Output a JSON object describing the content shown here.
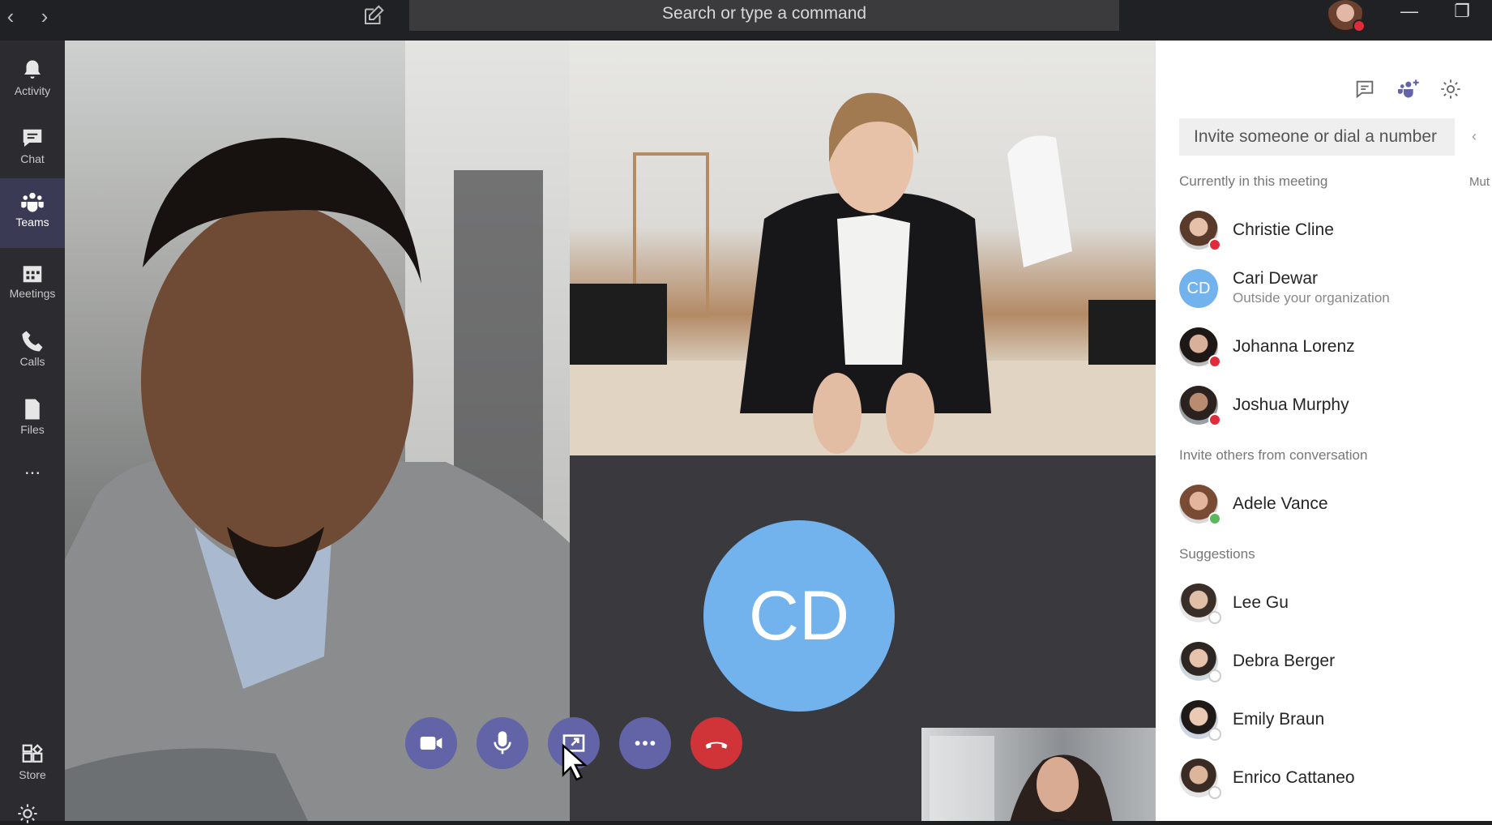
{
  "topbar": {
    "back_icon": "chevron-left",
    "forward_icon": "chevron-right",
    "compose_icon": "compose",
    "search_placeholder": "Search or type a command",
    "minimize": "—",
    "restore": "❐"
  },
  "rail": {
    "items": [
      {
        "label": "Activity",
        "icon": "bell"
      },
      {
        "label": "Chat",
        "icon": "chat"
      },
      {
        "label": "Teams",
        "icon": "teams",
        "active": true
      },
      {
        "label": "Meetings",
        "icon": "calendar"
      },
      {
        "label": "Calls",
        "icon": "phone"
      },
      {
        "label": "Files",
        "icon": "file"
      },
      {
        "label": "...",
        "icon": "more"
      },
      {
        "label": "Store",
        "icon": "store"
      }
    ]
  },
  "stage": {
    "cd_initials": "CD",
    "controls": [
      "video-camera",
      "microphone",
      "share-screen",
      "more-options",
      "hang-up"
    ]
  },
  "panel": {
    "header_icons": [
      "chat-icon",
      "add-people-icon",
      "settings-icon"
    ],
    "invite_placeholder": "Invite someone or dial a number",
    "section_current": "Currently in this meeting",
    "mute_label": "Mut",
    "current": [
      {
        "name": "Christie Cline",
        "status": "red"
      },
      {
        "name": "Cari Dewar",
        "sub": "Outside your organization",
        "initials": "CD"
      },
      {
        "name": "Johanna Lorenz",
        "status": "red"
      },
      {
        "name": "Joshua Murphy",
        "status": "red"
      }
    ],
    "section_conversation": "Invite others from conversation",
    "conversation": [
      {
        "name": "Adele Vance",
        "status": "green"
      }
    ],
    "section_suggestions": "Suggestions",
    "suggestions": [
      {
        "name": "Lee Gu"
      },
      {
        "name": "Debra Berger"
      },
      {
        "name": "Emily Braun"
      },
      {
        "name": "Enrico Cattaneo"
      }
    ]
  },
  "colors": {
    "accent": "#6264a7",
    "hangup": "#d13438",
    "busy": "#e02c3a",
    "available": "#5cb85c",
    "initials_bg": "#72b3ee"
  }
}
